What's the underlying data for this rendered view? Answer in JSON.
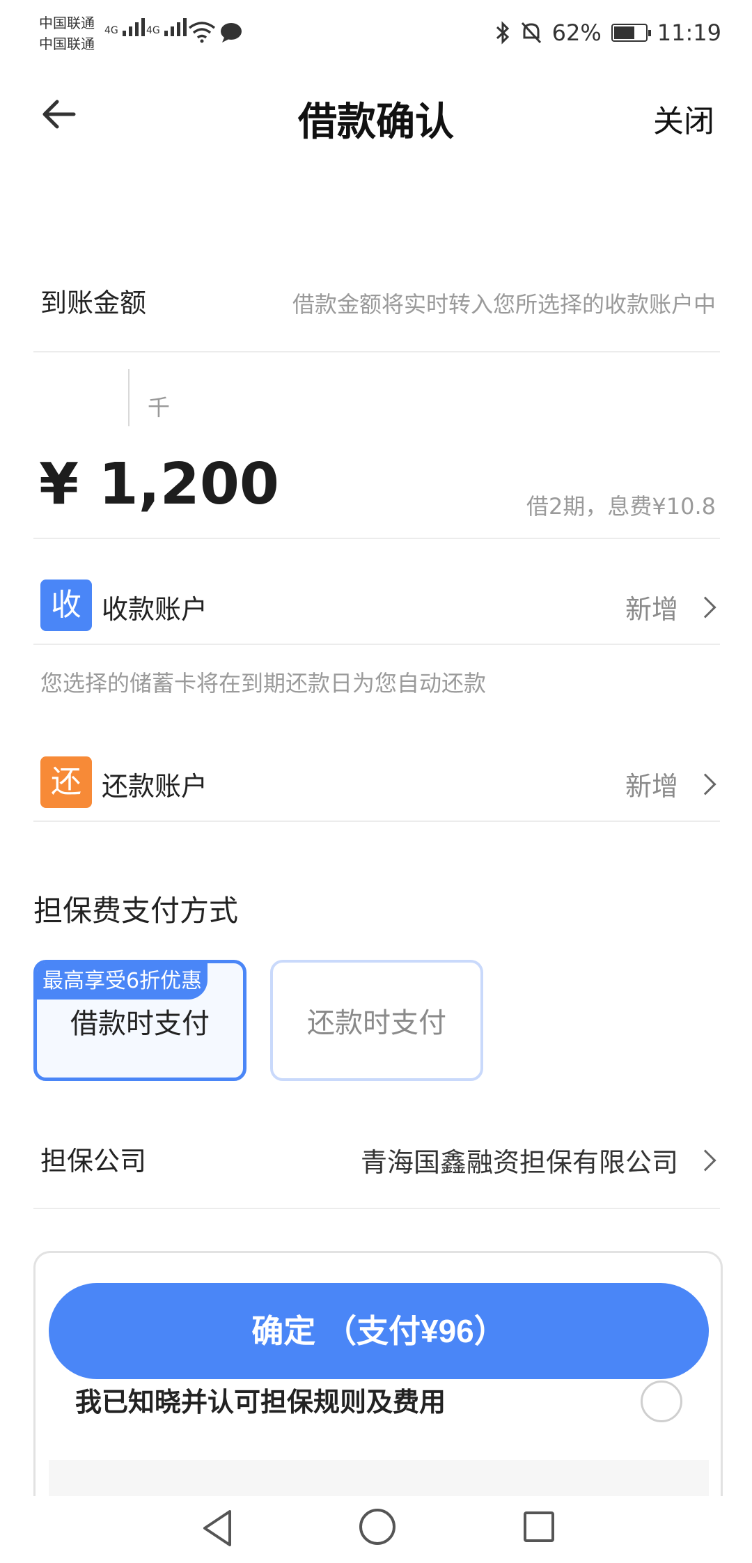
{
  "status_bar": {
    "carrier1": "中国联通",
    "carrier2": "中国联通",
    "net1": "4G",
    "net2": "4G",
    "battery": "62%",
    "time": "11:19"
  },
  "header": {
    "title": "借款确认",
    "close_label": "关闭"
  },
  "amount_section": {
    "label": "到账金额",
    "hint": "借款金额将实时转入您所选择的收款账户中",
    "unit": "千",
    "amount": "¥ 1,200",
    "terms": "借2期，息费¥10.8"
  },
  "receive_account": {
    "badge": "收",
    "label": "收款账户",
    "action": "新增"
  },
  "repay_note": "您选择的储蓄卡将在到期还款日为您自动还款",
  "repay_account": {
    "badge": "还",
    "label": "还款账户",
    "action": "新增"
  },
  "fee_payment": {
    "title": "担保费支付方式",
    "options": [
      {
        "label": "借款时支付",
        "promo": "最高享受6折优惠",
        "selected": true
      },
      {
        "label": "还款时支付",
        "selected": false
      }
    ]
  },
  "guarantor": {
    "label": "担保公司",
    "value": "青海国鑫融资担保有限公司"
  },
  "confirm": {
    "button_label": "确定 （支付¥96）",
    "agreement": "我已知晓并认可担保规则及费用"
  },
  "colors": {
    "accent": "#4a86f7",
    "orange": "#f78a37"
  }
}
